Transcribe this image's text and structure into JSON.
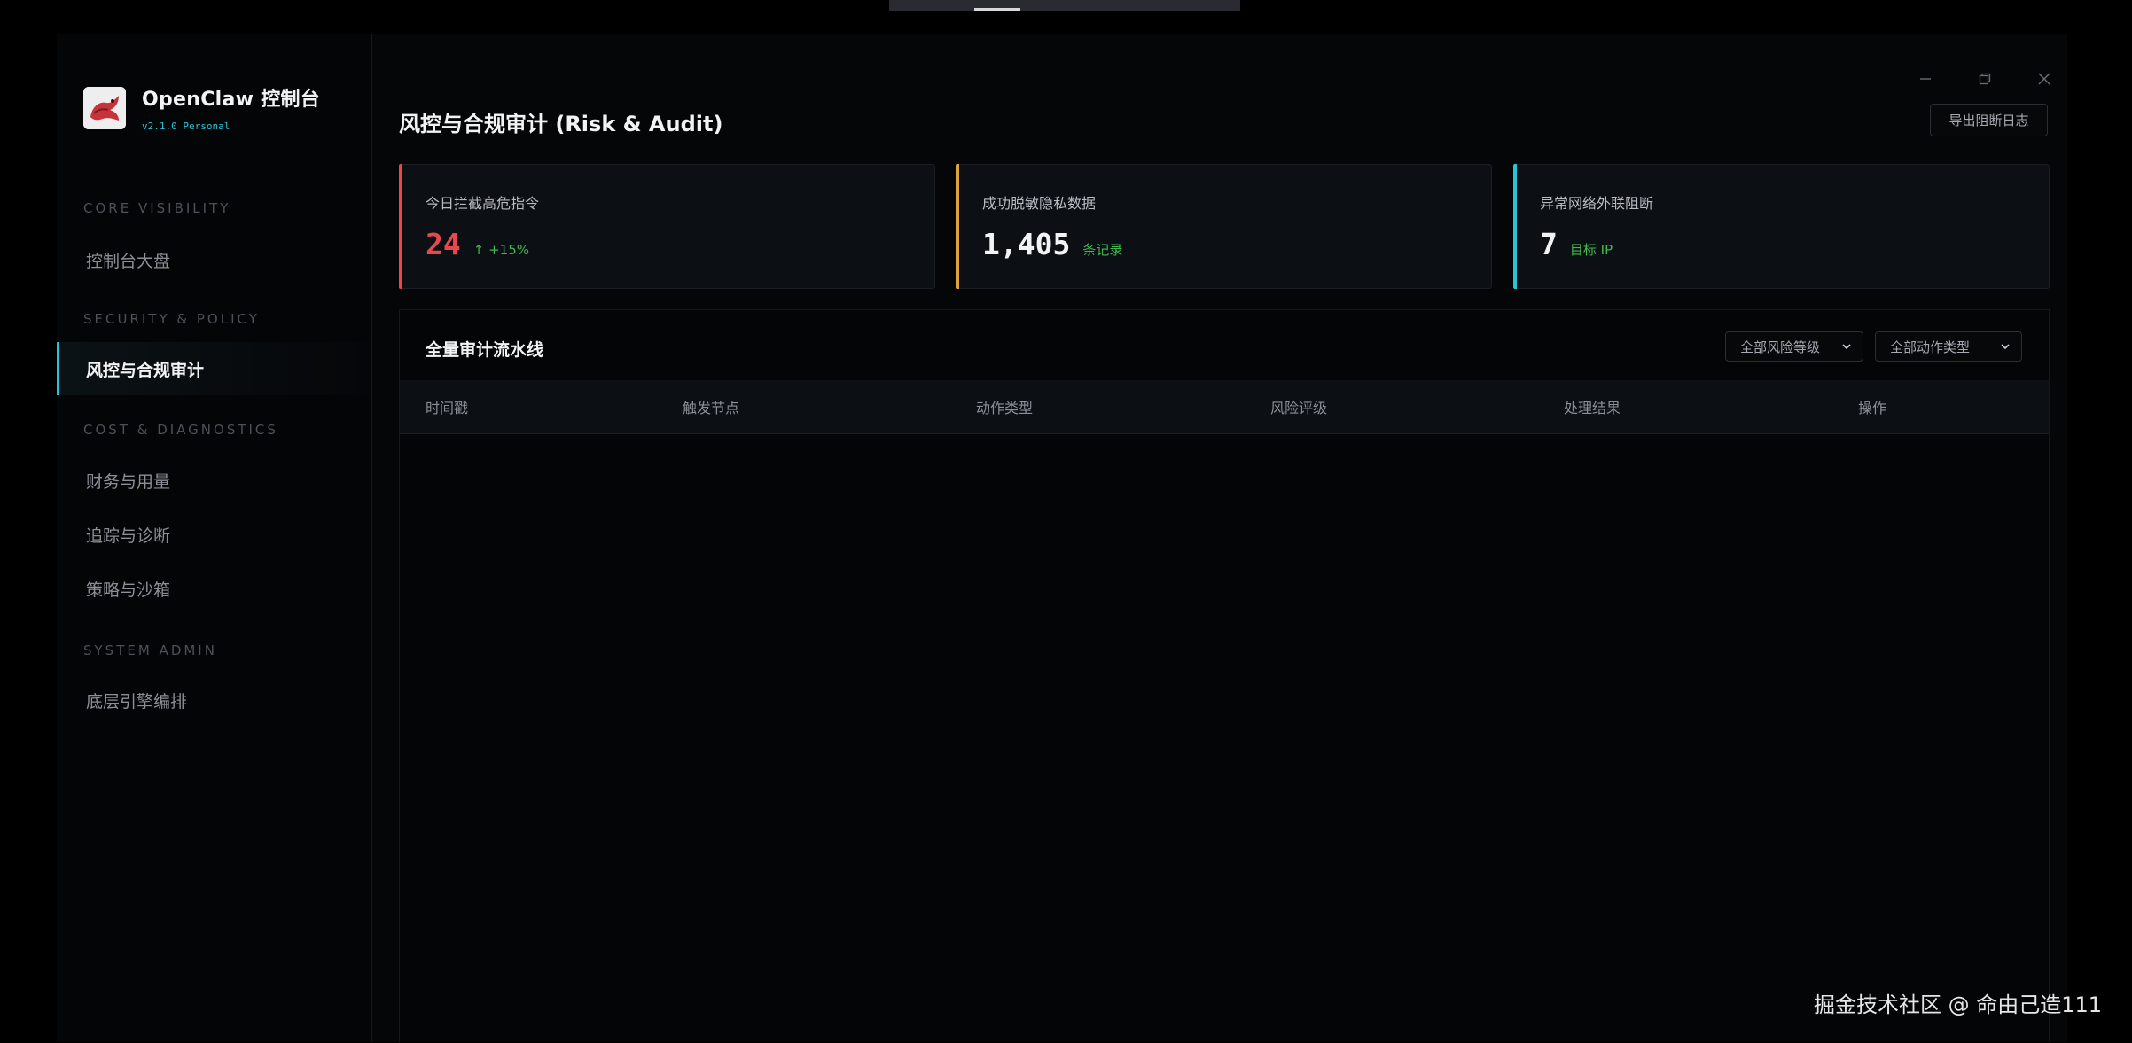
{
  "brand": {
    "title": "OpenClaw 控制台",
    "version": "v2.1.0 Personal"
  },
  "nav": {
    "groups": [
      {
        "title": "CORE VISIBILITY",
        "items": [
          {
            "label": "控制台大盘",
            "active": false
          }
        ]
      },
      {
        "title": "SECURITY & POLICY",
        "items": [
          {
            "label": "风控与合规审计",
            "active": true
          }
        ]
      },
      {
        "title": "COST & DIAGNOSTICS",
        "items": [
          {
            "label": "财务与用量",
            "active": false
          },
          {
            "label": "追踪与诊断",
            "active": false
          },
          {
            "label": "策略与沙箱",
            "active": false
          }
        ]
      },
      {
        "title": "SYSTEM ADMIN",
        "items": [
          {
            "label": "底层引擎编排",
            "active": false
          }
        ]
      }
    ]
  },
  "window_controls": {
    "minimize_icon": "minimize-icon",
    "restore_icon": "restore-icon",
    "close_icon": "close-icon"
  },
  "page": {
    "title": "风控与合规审计 (Risk & Audit)",
    "export_label": "导出阻断日志"
  },
  "cards": [
    {
      "label": "今日拦截高危指令",
      "value": "24",
      "sub": "↑ +15%",
      "accent": "#e5484d",
      "value_color": "#e5484d"
    },
    {
      "label": "成功脱敏隐私数据",
      "value": "1,405",
      "sub": "条记录",
      "accent": "#e0a33a",
      "value_color": "#f2f3f5"
    },
    {
      "label": "异常网络外联阻断",
      "value": "7",
      "sub": "目标 IP",
      "accent": "#2bc3d6",
      "value_color": "#f2f3f5"
    }
  ],
  "table": {
    "title": "全量审计流水线",
    "filters": {
      "risk_level": "全部风险等级",
      "action_type": "全部动作类型"
    },
    "columns": [
      "时间戳",
      "触发节点",
      "动作类型",
      "风险评级",
      "处理结果",
      "操作"
    ],
    "rows": []
  },
  "watermark": "掘金技术社区 @ 命由己造111"
}
